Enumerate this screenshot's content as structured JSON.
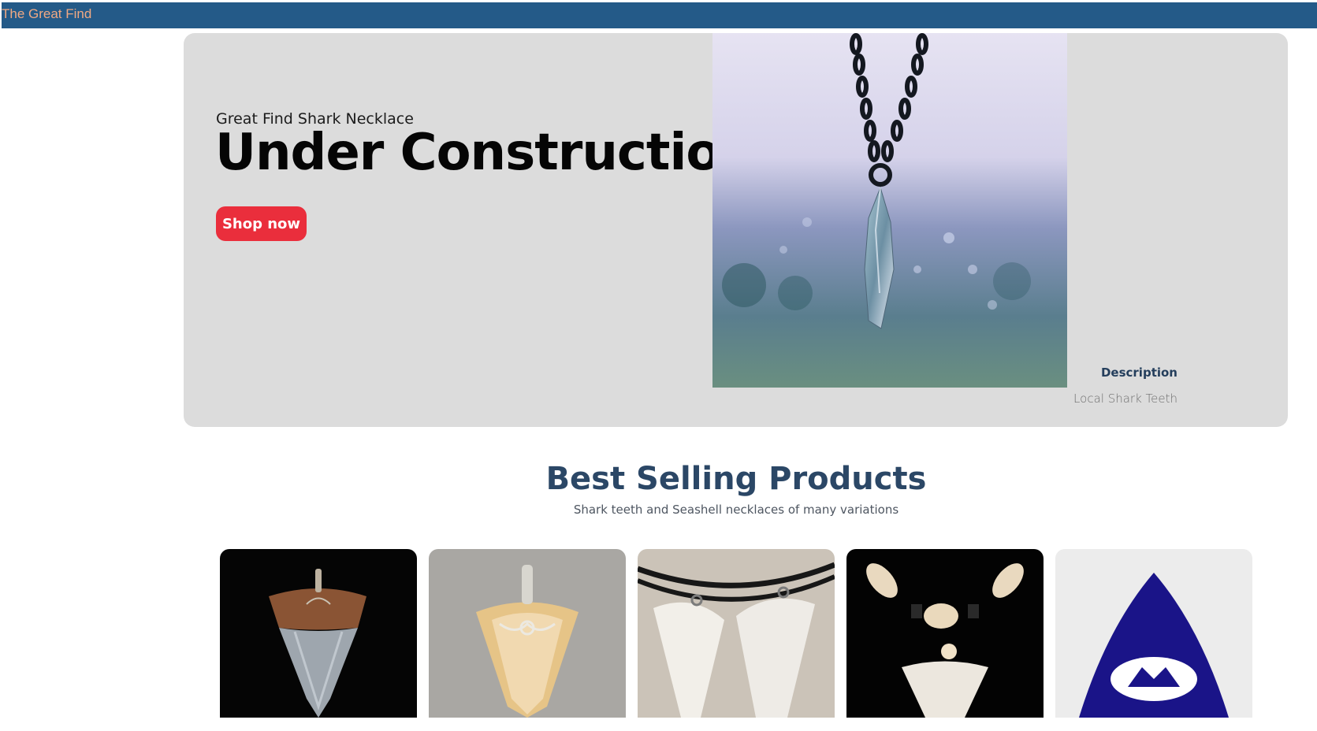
{
  "header": {
    "brand": "The Great Find"
  },
  "hero": {
    "subtitle": "Great Find Shark Necklace",
    "title": "Under Construction",
    "cta_label": "Shop now",
    "description_label": "Description",
    "description_text": "Local Shark Teeth"
  },
  "best_selling": {
    "title": "Best Selling Products",
    "subtitle": "Shark teeth and Seashell necklaces of many variations",
    "products": [
      {
        "image": "shark-tooth-wrapped-pendant-dark"
      },
      {
        "image": "fossil-tooth-silver-wire-pendant"
      },
      {
        "image": "two-white-shark-teeth-necklaces"
      },
      {
        "image": "beaded-shark-tooth-necklace"
      },
      {
        "image": "shark-fin-logo"
      }
    ]
  },
  "colors": {
    "header_bg": "#245a88",
    "brand_text": "#f0a983",
    "hero_bg": "#dcdcdc",
    "cta_bg": "#ea2e3c",
    "heading": "#2b4766",
    "logo_blue": "#1a1488"
  }
}
